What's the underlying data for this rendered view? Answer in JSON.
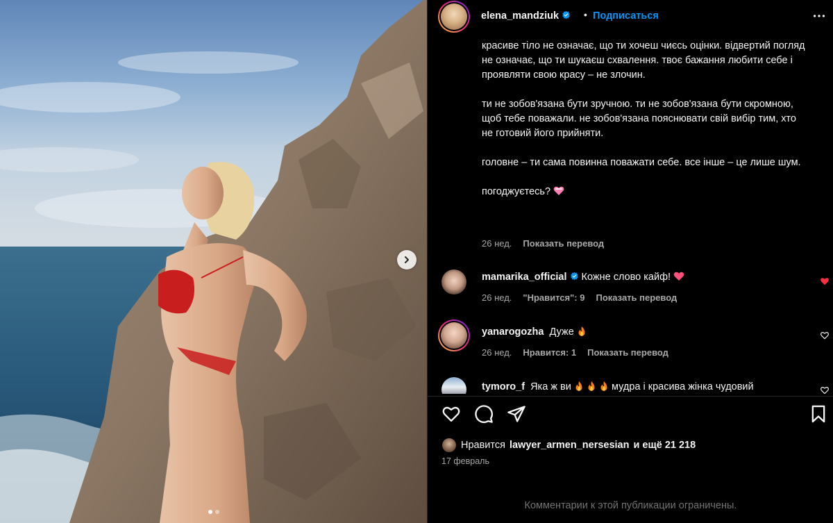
{
  "post": {
    "username": "elena_mandziuk",
    "separator": "•",
    "follow_label": "Подписаться",
    "caption_paragraphs": [
      "красиве тіло не означає, що ти хочеш чиєсь оцінки. відвертий погляд не означає, що ти шукаєш схвалення. твоє бажання любити себе і проявляти свою красу – не злочин.",
      "ти не зобов'язана бути зручною. ти не зобов'язана бути скромною, щоб тебе поважали. не зобов'язана пояснювати свій вибір тим, хто не готовий його прийняти.",
      "головне – ти сама повинна поважати себе. все інше – це лише шум.",
      "погоджуєтесь?"
    ],
    "caption_time": "26 нед.",
    "translate_label": "Показать перевод"
  },
  "comments": [
    {
      "username": "mamarika_official",
      "verified": true,
      "text": "Кожне слово кайф!",
      "time": "26 нед.",
      "likes": "\"Нравится\": 9",
      "translate": "Показать перевод",
      "liked": true
    },
    {
      "username": "yanarogozha",
      "verified": false,
      "text": "Дуже",
      "time": "26 нед.",
      "likes": "Нравится: 1",
      "translate": "Показать перевод",
      "liked": false
    },
    {
      "username": "tymoro_f",
      "verified": false,
      "text": "Яка ж ви",
      "text_tail": "мудра і красива жінка чудовий",
      "liked": false
    }
  ],
  "likes": {
    "prefix": "Нравится",
    "user": "lawyer_armen_nersesian",
    "suffix": "и ещё 21 218"
  },
  "date": "17 февраль",
  "comments_limited": "Комментарии к этой публикации ограничены.",
  "colors": {
    "accent": "#0095f6",
    "liked": "#ff3040",
    "muted": "#a8a8a8"
  },
  "icons": [
    "more-icon",
    "verified-icon",
    "heart-icon",
    "comment-icon",
    "share-icon",
    "bookmark-icon",
    "chevron-right-icon",
    "fire-emoji",
    "heart-emoji"
  ],
  "carousel": {
    "slides": 2,
    "current": 1
  }
}
